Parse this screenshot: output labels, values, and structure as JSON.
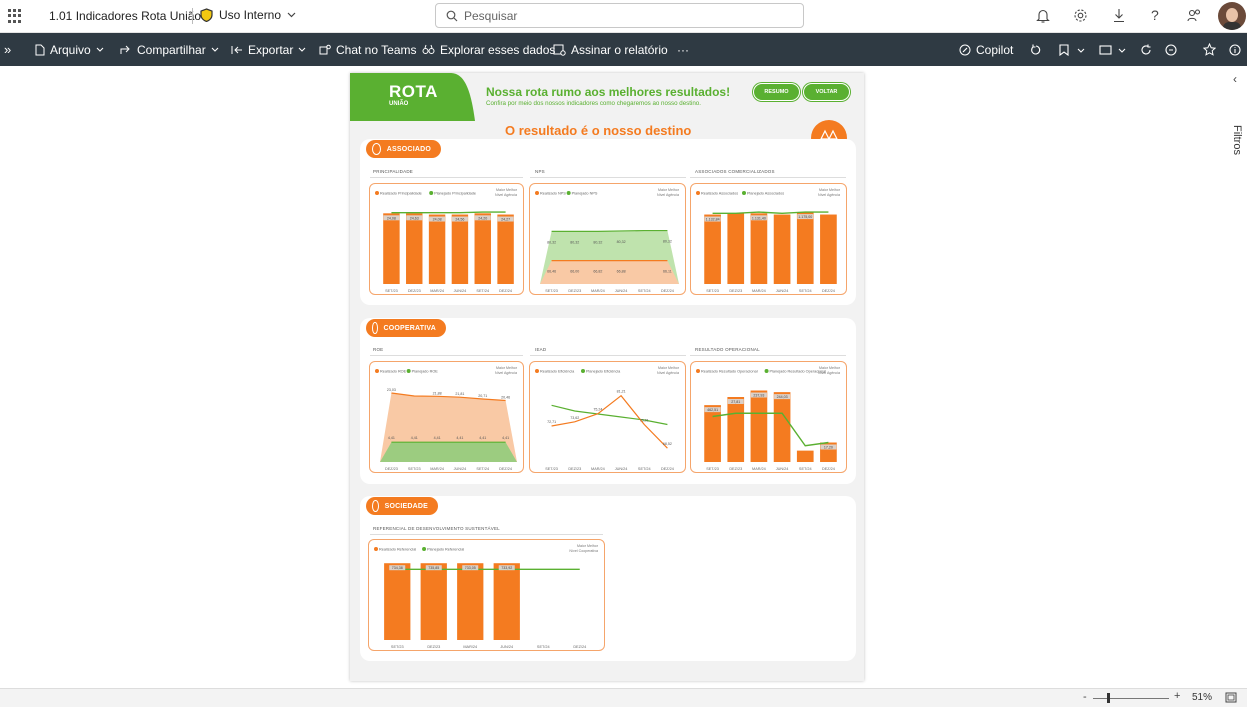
{
  "app": {
    "title": "1.01 Indicadores Rota União",
    "sensitivity": "Uso Interno",
    "search_placeholder": "Pesquisar"
  },
  "toolbar": {
    "file": "Arquivo",
    "share": "Compartilhar",
    "export": "Exportar",
    "teams": "Chat no Teams",
    "explore": "Explorar esses dados",
    "subscribe": "Assinar o relatório",
    "more": "···",
    "copilot": "Copilot"
  },
  "filters_pane": {
    "label": "Filtros"
  },
  "status": {
    "zoom": "51%",
    "minus": "-",
    "plus": "+"
  },
  "report": {
    "logo_main": "ROTA",
    "logo_sub": "UNIÃO",
    "headline": "Nossa rota rumo aos melhores resultados!",
    "subheadline": "Confira por meio dos nossos indicadores como chegaremos ao nosso destino.",
    "btn_resumo": "RESUMO",
    "btn_voltar": "VOLTAR",
    "main_title": "O resultado é o nosso destino",
    "sections": {
      "associado": "ASSOCIADO",
      "cooperativa": "COOPERATIVA",
      "sociedade": "SOCIEDADE"
    },
    "note": "Maior Melhor\nNível Agência",
    "note_coop": "Maior Melhor\nNível Cooperativa"
  },
  "colors": {
    "orange": "#f47b20",
    "green": "#5ab031",
    "light_orange": "#f9c9a5",
    "light_green": "#bfe3ad"
  },
  "chart_data": [
    {
      "id": "principalidade",
      "title": "PRINCIPALIDADE",
      "type": "bar",
      "legend": [
        "Realizado Principalidade",
        "Planejado Principalidade"
      ],
      "categories": [
        "SET/23",
        "DEZ/23",
        "MAR/24",
        "JUN/24",
        "SET/24",
        "DEZ/24"
      ],
      "series": [
        {
          "name": "Realizado Principalidade",
          "values": [
            58,
            58,
            57,
            57,
            58,
            57
          ]
        },
        {
          "name": "Planejado Principalidade",
          "values": [
            58.5,
            58.5,
            58.5,
            58.5,
            59,
            59
          ]
        }
      ],
      "bar_labels": [
        "24,08",
        "24,63",
        "24,08",
        "24,56",
        "24,20",
        "24,27"
      ]
    },
    {
      "id": "nps",
      "title": "NPS",
      "type": "area",
      "legend": [
        "Realizado NPS",
        "Planejado NPS"
      ],
      "categories": [
        "SET/23",
        "DEZ/23",
        "MAR/24",
        "JUN/24",
        "SET/24",
        "DEZ/24"
      ],
      "series": [
        {
          "name": "Realizado NPS",
          "values": [
            66.0,
            66.0,
            66.0,
            66.0,
            66.0,
            66.0
          ]
        },
        {
          "name": "Planejado NPS",
          "values": [
            73.5,
            73.5,
            73.5,
            73.6,
            73.7,
            73.7
          ]
        }
      ],
      "labels_top": [
        "80,32",
        "80,32",
        "80,32",
        "80,32",
        "",
        "80,32"
      ],
      "labels_bottom": [
        "66,46",
        "66,00",
        "66,82",
        "66,88",
        "",
        "66,11"
      ]
    },
    {
      "id": "assoc_ativos",
      "title": "ASSOCIADOS COMERCIALIZADOS",
      "type": "bar",
      "legend": [
        "Realizado Associados",
        "Planejado Associados"
      ],
      "categories": [
        "SET/23",
        "DEZ/23",
        "MAR/24",
        "JUN/24",
        "SET/24",
        "DEZ/24"
      ],
      "series": [
        {
          "name": "Realizado Associados",
          "values": [
            57,
            58,
            58,
            57,
            59,
            57
          ]
        },
        {
          "name": "Planejado Associados",
          "values": [
            58,
            58,
            59,
            58,
            59,
            59
          ]
        }
      ],
      "bar_labels": [
        "1.132,84",
        "",
        "1.131,40",
        "",
        "1.175,00",
        ""
      ]
    },
    {
      "id": "roe",
      "title": "ROE",
      "type": "area",
      "legend": [
        "Realizado ROE",
        "Planejado ROE"
      ],
      "categories": [
        "DEZ/23",
        "SET/23",
        "MAR/24",
        "JUN/24",
        "SET/24",
        "DEZ/24"
      ],
      "series": [
        {
          "name": "Realizado ROE",
          "values": [
            23.0,
            22.0,
            21.9,
            21.6,
            21.0,
            20.5
          ]
        },
        {
          "name": "Planejado ROE",
          "values": [
            6.6,
            6.6,
            6.6,
            6.6,
            6.6,
            6.6
          ]
        }
      ],
      "labels_top": [
        "23,03",
        "",
        "21,88",
        "21,81",
        "20,71",
        "20,46"
      ],
      "labels_bottom": [
        "4,41",
        "4,41",
        "4,41",
        "4,41",
        "4,41",
        "4,41"
      ]
    },
    {
      "id": "iead",
      "title": "IEAD",
      "type": "line",
      "legend": [
        "Realizado Eficiência",
        "Planejado Eficiência"
      ],
      "categories": [
        "SET/23",
        "DEZ/23",
        "MAR/24",
        "JUN/24",
        "SET/24",
        "DEZ/24"
      ],
      "series": [
        {
          "name": "Realizado Eficiência",
          "values": [
            72.0,
            73.4,
            76.1,
            82.1,
            72.5,
            64.6
          ]
        },
        {
          "name": "Planejado Eficiência",
          "values": [
            78.9,
            77.0,
            76.0,
            75.0,
            74.0,
            72.5
          ]
        }
      ],
      "point_labels": [
        "72,71",
        "73,62",
        "75,24",
        "81,21",
        "75,01",
        "68,52"
      ]
    },
    {
      "id": "resultado_op",
      "title": "RESULTADO OPERACIONAL",
      "type": "bar",
      "legend": [
        "Realizado Resultado Operacional",
        "Planejado Resultado Operacional"
      ],
      "categories": [
        "SET/23",
        "DEZ/23",
        "MAR/24",
        "JUN/24",
        "SET/24",
        "DEZ/24"
      ],
      "series": [
        {
          "name": "Realizado Resultado Operacional",
          "values": [
            35,
            40,
            44,
            43,
            7,
            12
          ]
        },
        {
          "name": "Planejado Resultado Operacional",
          "values": [
            28,
            30,
            30,
            30,
            10,
            12
          ]
        }
      ],
      "bar_labels": [
        "462,51",
        "27,81",
        "237,93",
        "244,03",
        "",
        "17,20"
      ]
    },
    {
      "id": "referencial",
      "title": "REFERENCIAL DE DESENVOLVIMENTO SUSTENTÁVEL",
      "type": "bar",
      "legend": [
        "Realizado Referencial",
        "Planejado Referencial"
      ],
      "categories": [
        "SET/23",
        "DEZ/23",
        "MAR/24",
        "JUN/24",
        "SET/24",
        "DEZ/24"
      ],
      "series": [
        {
          "name": "Realizado Referencial",
          "values": [
            63,
            63,
            63,
            63,
            null,
            null
          ]
        },
        {
          "name": "Planejado Referencial",
          "values": [
            58,
            58,
            58,
            58,
            58,
            58
          ]
        }
      ],
      "bar_labels": [
        "734,38",
        "735,85",
        "733,05",
        "733,92",
        "",
        ""
      ]
    }
  ]
}
